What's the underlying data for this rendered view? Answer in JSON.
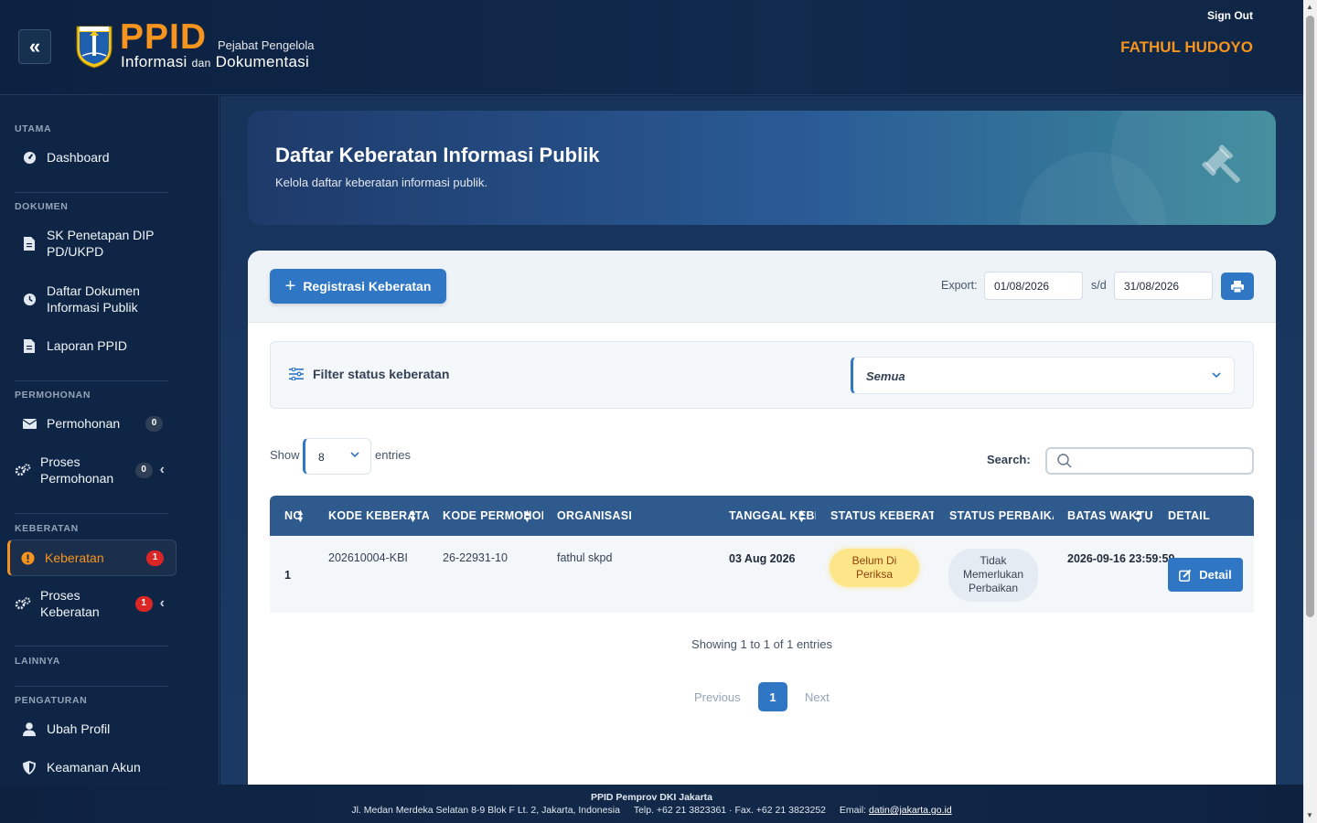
{
  "header": {
    "logo_main": "PPID",
    "logo_sub1": "Pejabat Pengelola",
    "logo_sub2a": "Informasi",
    "logo_sub2b": "dan",
    "logo_sub2c": "Dokumentasi",
    "signout_label": "Sign Out",
    "username": "FATHUL HUDOYO"
  },
  "sidebar": {
    "section_utama": "UTAMA",
    "dashboard": "Dashboard",
    "section_dokumen": "DOKUMEN",
    "sk_penetapan": "SK Penetapan DIP PD/UKPD",
    "daftar_dokumen": "Daftar Dokumen Informasi Publik",
    "laporan": "Laporan PPID",
    "section_permohonan": "PERMOHONAN",
    "permohonan": "Permohonan",
    "permohonan_badge": "0",
    "proses_permohonan": "Proses Permohonan",
    "proses_permohonan_badge": "0",
    "section_keberatan": "KEBERATAN",
    "keberatan": "Keberatan",
    "keberatan_badge": "1",
    "proses_keberatan": "Proses Keberatan",
    "proses_keberatan_badge": "1",
    "section_lainnya": "LAINNYA",
    "section_pengaturan": "PENGATURAN",
    "ubah_profil": "Ubah Profil",
    "keamanan_akun": "Keamanan Akun"
  },
  "hero": {
    "title": "Daftar Keberatan Informasi Publik",
    "subtitle": "Kelola daftar keberatan informasi publik."
  },
  "toolbar": {
    "register_label": "Registrasi Keberatan",
    "export_label": "Export:",
    "date_from": "01/08/2026",
    "sd_label": "s/d",
    "date_to": "31/08/2026"
  },
  "filter": {
    "label": "Filter status keberatan",
    "selected": "Semua"
  },
  "table_controls": {
    "show_label": "Show",
    "show_value": "8",
    "entries_label": "entries",
    "search_label": "Search:"
  },
  "table": {
    "columns": [
      "NO",
      "KODE KEBERATAN",
      "KODE PERMOHONAN",
      "ORGANISASI",
      "TANGGAL KEBERATAN",
      "STATUS KEBERATAN",
      "STATUS PERBAIKAN",
      "BATAS WAKTU",
      "DETAIL"
    ],
    "rows": [
      {
        "no": "1",
        "kode_keberatan": "202610004-KBI",
        "kode_permohonan": "26-22931-10",
        "organisasi": "fathul skpd",
        "tanggal": "03 Aug 2026",
        "status_keberatan_1": "Belum Di",
        "status_keberatan_2": "Periksa",
        "status_perbaikan_1": "Tidak",
        "status_perbaikan_2": "Memerlukan",
        "status_perbaikan_3": "Perbaikan",
        "batas_waktu": "2026-09-16 23:59:59",
        "detail_label": "Detail"
      }
    ]
  },
  "pagination": {
    "summary": "Showing 1 to 1 of 1 entries",
    "previous": "Previous",
    "current": "1",
    "next": "Next"
  },
  "footer": {
    "org": "PPID Pemprov DKI Jakarta",
    "address": "Jl. Medan Merdeka Selatan 8-9 Blok F Lt. 2, Jakarta, Indonesia",
    "phone": "Telp. +62 21 3823361 · Fax. +62 21 3823252",
    "email_label": "Email:",
    "email": "datin@jakarta.go.id"
  },
  "colors": {
    "accent": "#2f77c4",
    "brand_orange": "#f7941d",
    "sidebar_bg": "#0f2545",
    "badge_red": "#dc2626"
  }
}
